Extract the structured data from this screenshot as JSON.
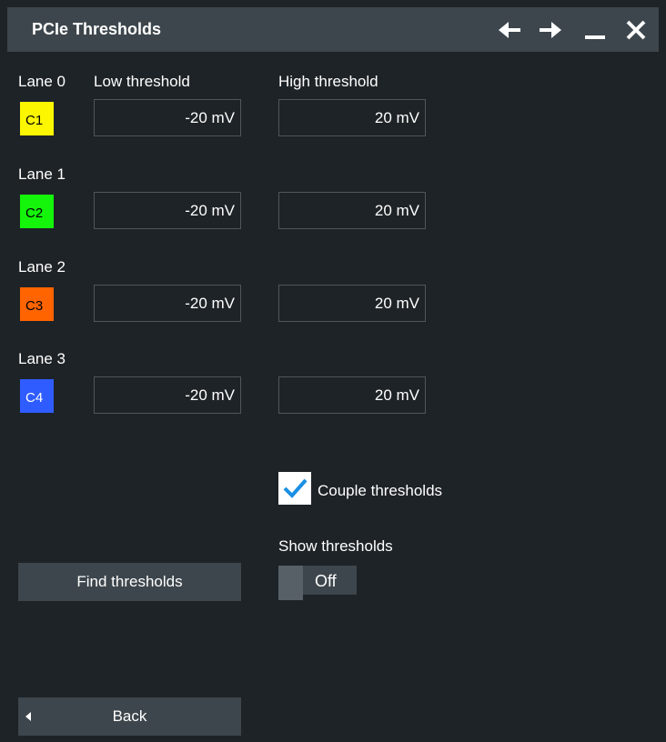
{
  "window": {
    "title": "PCIe Thresholds",
    "controls": [
      "back-arrow-icon",
      "forward-arrow-icon",
      "minimize-icon",
      "close-icon"
    ]
  },
  "columns": {
    "low": "Low threshold",
    "high": "High threshold"
  },
  "lanes": [
    {
      "label": "Lane 0",
      "channel": "C1",
      "color": "#fcf600",
      "text_color": "#000000",
      "low": "-20 mV",
      "high": "20 mV"
    },
    {
      "label": "Lane 1",
      "channel": "C2",
      "color": "#14f50b",
      "text_color": "#000000",
      "low": "-20 mV",
      "high": "20 mV"
    },
    {
      "label": "Lane 2",
      "channel": "C3",
      "color": "#ff6400",
      "text_color": "#000000",
      "low": "-20 mV",
      "high": "20 mV"
    },
    {
      "label": "Lane 3",
      "channel": "C4",
      "color": "#2f5cff",
      "text_color": "#ffffff",
      "low": "-20 mV",
      "high": "20 mV"
    }
  ],
  "couple": {
    "label": "Couple thresholds",
    "checked": true
  },
  "show_thresholds": {
    "label": "Show thresholds",
    "state": "Off"
  },
  "buttons": {
    "find": "Find thresholds",
    "back": "Back"
  },
  "colors": {
    "background": "#1e2327",
    "titlebar": "#3d464c",
    "button": "#3d464c",
    "field_border": "#4e575d",
    "check_accent": "#1a8fe3"
  }
}
